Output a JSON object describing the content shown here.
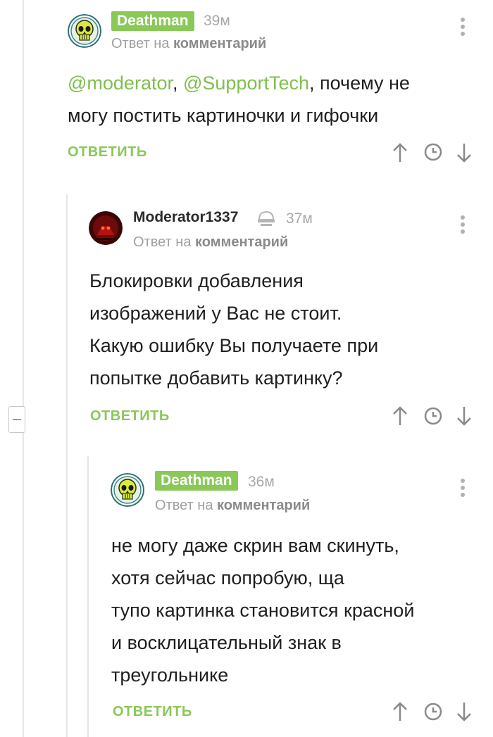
{
  "thread": {
    "comments": [
      {
        "author": "Deathman",
        "time": "39м",
        "reply_prefix": "Ответ на",
        "reply_target": "комментарий",
        "mention1": "@moderator",
        "sep": ", ",
        "mention2": "@SupportTech",
        "text_line1_rest": ",  почему не",
        "text_line2": "могу постить картиночки и гифочки",
        "reply_label": "ОТВЕТИТЬ"
      },
      {
        "author": "Moderator1337",
        "time": "37м",
        "reply_prefix": "Ответ на",
        "reply_target": "комментарий",
        "text_lines": [
          "Блокировки добавления",
          "изображений у Вас не стоит.",
          "Какую ошибку Вы получаете при",
          "попытке добавить картинку?"
        ],
        "reply_label": "ОТВЕТИТЬ"
      },
      {
        "author": "Deathman",
        "time": "36м",
        "reply_prefix": "Ответ на",
        "reply_target": "комментарий",
        "text_lines": [
          "не могу даже скрин вам скинуть,",
          "хотя сейчас попробую, ща",
          "тупо картинка становится красной",
          "и восклицательный знак в",
          "треугольнике"
        ],
        "reply_label": "ОТВЕТИТЬ"
      }
    ]
  },
  "colors": {
    "accent_green": "#8ac858",
    "mention_green": "#7fbf4d",
    "muted_gray": "#a8a8a8"
  },
  "icons": [
    "skull-avatar-icon",
    "moderator-avatar-icon",
    "moderator-badge-icon",
    "menu-dots-icon",
    "arrow-up-icon",
    "clock-icon",
    "arrow-down-icon",
    "collapse-icon"
  ]
}
